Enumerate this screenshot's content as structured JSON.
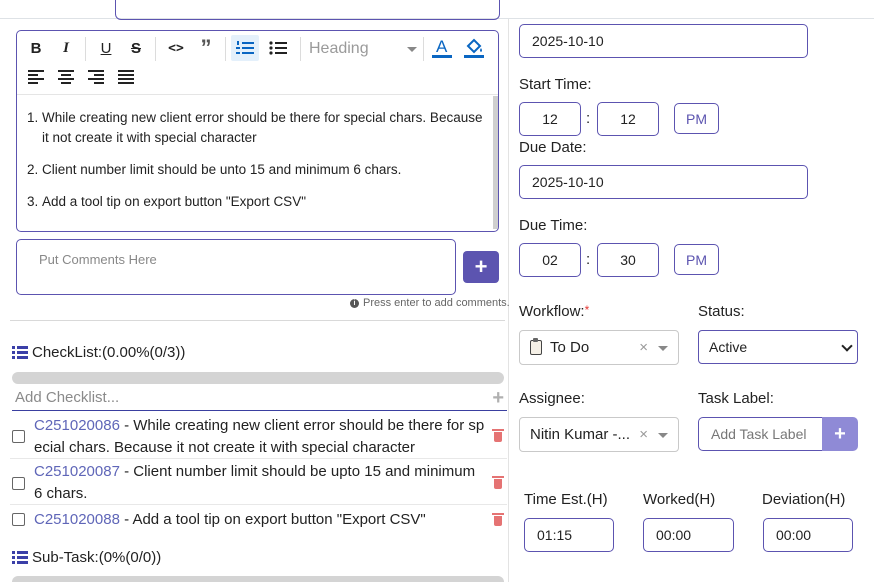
{
  "editor": {
    "toolbar": {
      "bold": "B",
      "italic": "I",
      "underline": "U",
      "strike": "S",
      "code": "<>",
      "quote": "”",
      "heading": "Heading"
    },
    "items": [
      {
        "num": "1.",
        "text": "While creating new client error should be there for special chars. Because it not create it with special character"
      },
      {
        "num": "2.",
        "text": "Client number limit should be unto 15 and minimum 6 chars."
      },
      {
        "num": "3.",
        "text": " Add a tool tip on export button \"Export CSV\""
      }
    ]
  },
  "comment": {
    "placeholder": "Put Comments Here",
    "add_label": "+",
    "hint": "Press enter to add comments."
  },
  "checklist": {
    "title": "CheckList:(0.00%(0/3))",
    "progress": 0,
    "add_placeholder": "Add Checklist...",
    "items": [
      {
        "code": "C251020086",
        "sep": " - ",
        "text": "While creating new client error should be there for special chars. Because it not create it with special character",
        "checked": false
      },
      {
        "code": "C251020087",
        "sep": " - ",
        "text": "Client number limit should be upto 15 and minimum 6 chars.",
        "checked": false
      },
      {
        "code": "C251020088",
        "sep": " - ",
        "text": "Add a tool tip on export button \"Export CSV\"",
        "checked": false
      }
    ]
  },
  "subtask": {
    "title": "Sub-Task:(0%(0/0))"
  },
  "right": {
    "start_date": "2025-10-10",
    "start_time_label": "Start Time:",
    "start_hour": "12",
    "start_minute": "12",
    "start_ampm": "PM",
    "due_date_label": "Due Date:",
    "due_date": "2025-10-10",
    "due_time_label": "Due Time:",
    "due_hour": "02",
    "due_minute": "30",
    "due_ampm": "PM",
    "colon": ":",
    "workflow_label": "Workflow:",
    "required_mark": "*",
    "workflow_value": "To Do",
    "status_label": "Status:",
    "status_value": "Active",
    "assignee_label": "Assignee:",
    "assignee_value": "Nitin Kumar -...",
    "task_label_label": "Task Label:",
    "task_label_placeholder": "Add Task Label",
    "task_label_add": "+",
    "time_est_label": "Time Est.(H)",
    "time_est_value": "01:15",
    "worked_label": "Worked(H)",
    "worked_value": "00:00",
    "deviation_label": "Deviation(H)",
    "deviation_value": "00:00",
    "clear_x": "×"
  },
  "colors": {
    "accent": "#5c54b0",
    "link_code": "#5f66b8",
    "trash": "#e57373",
    "progress_track": "#d4d4d4"
  }
}
